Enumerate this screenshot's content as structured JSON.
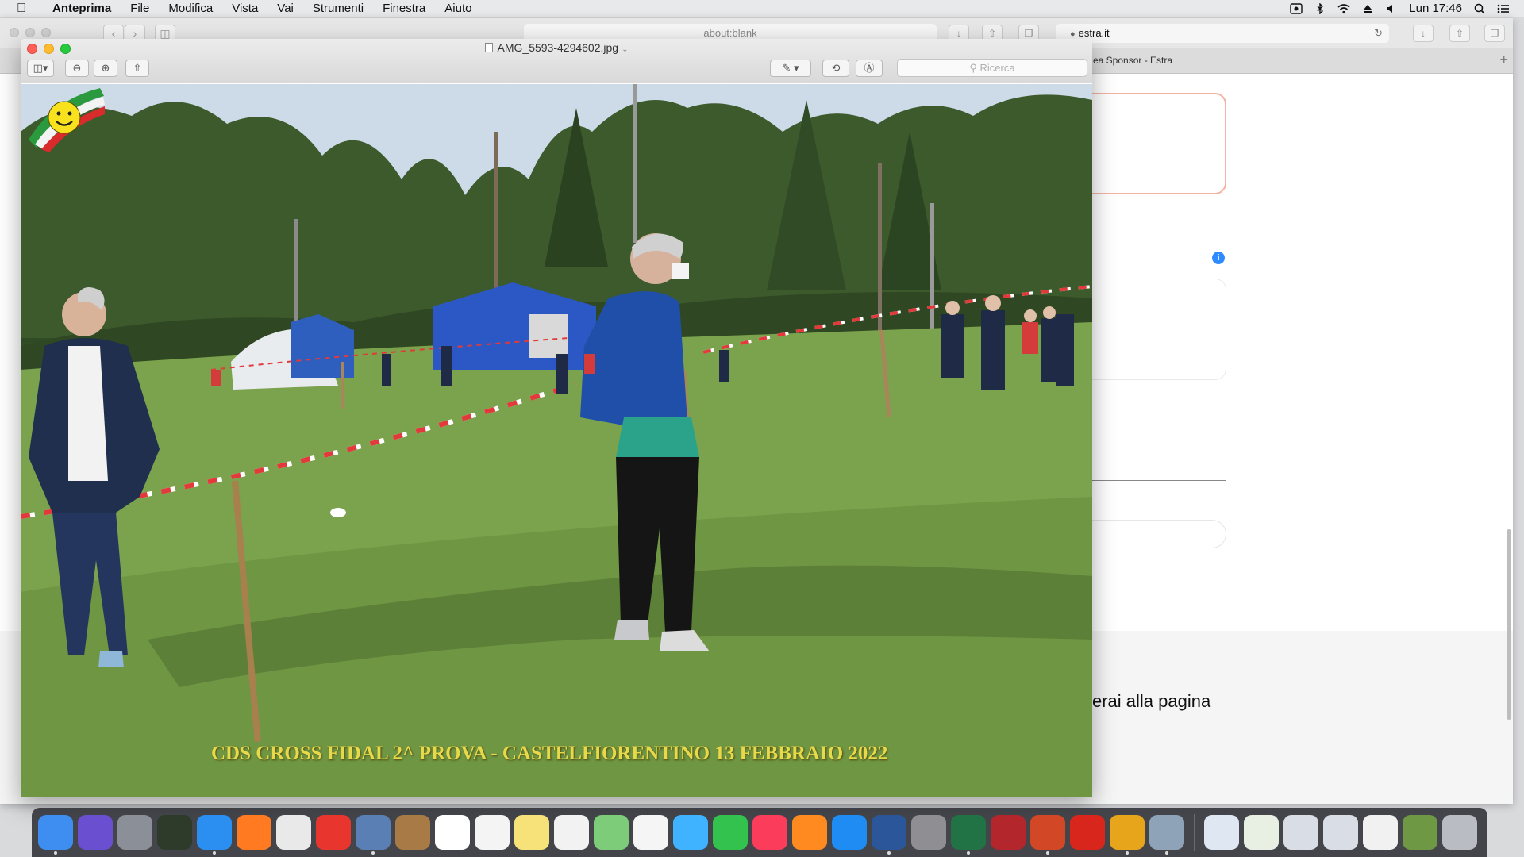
{
  "menubar": {
    "app_name": "Anteprima",
    "items": [
      "File",
      "Modifica",
      "Vista",
      "Vai",
      "Strumenti",
      "Finestra",
      "Aiuto"
    ],
    "clock": "Lun 17:46"
  },
  "safari": {
    "blank_url": "about:blank",
    "site_url": "estra.it",
    "tab_title": "ea Sponsor - Estra",
    "page_text": "erai alla pagina"
  },
  "preview": {
    "title": "AMG_5593-4294602.jpg",
    "search_placeholder": "Ricerca",
    "caption": "CDS CROSS FIDAL 2^ PROVA - CASTELFIORENTINO 13 FEBBRAIO 2022"
  },
  "dock": {
    "apps": [
      {
        "name": "finder-icon",
        "color": "#3d8ef0",
        "running": true
      },
      {
        "name": "siri-icon",
        "color": "#6a4fd0",
        "running": false
      },
      {
        "name": "launchpad-icon",
        "color": "#8a8f98",
        "running": false
      },
      {
        "name": "mission-control-icon",
        "color": "#2e3a2a",
        "running": false
      },
      {
        "name": "safari-icon",
        "color": "#2a8ff0",
        "running": true
      },
      {
        "name": "firefox-icon",
        "color": "#ff7a20",
        "running": false
      },
      {
        "name": "chrome-icon",
        "color": "#e9e9e9",
        "running": false
      },
      {
        "name": "anydesk-icon",
        "color": "#e8352d",
        "running": false
      },
      {
        "name": "preview-icon",
        "color": "#5a7fb5",
        "running": true
      },
      {
        "name": "notes-book-icon",
        "color": "#a87a45",
        "running": false
      },
      {
        "name": "calendar-icon",
        "color": "#ffffff",
        "running": false
      },
      {
        "name": "reminders-icon",
        "color": "#f4f4f4",
        "running": false
      },
      {
        "name": "stickies-icon",
        "color": "#f7e27a",
        "running": false
      },
      {
        "name": "textedit-icon",
        "color": "#f2f2f2",
        "running": false
      },
      {
        "name": "maps-icon",
        "color": "#7ccc7a",
        "running": false
      },
      {
        "name": "photos-icon",
        "color": "#f5f5f5",
        "running": false
      },
      {
        "name": "messages-icon",
        "color": "#3fb3ff",
        "running": false
      },
      {
        "name": "facetime-icon",
        "color": "#32c24d",
        "running": false
      },
      {
        "name": "music-icon",
        "color": "#fb3c5a",
        "running": false
      },
      {
        "name": "books-icon",
        "color": "#ff8a1f",
        "running": false
      },
      {
        "name": "app-store-icon",
        "color": "#1f8cf4",
        "running": false
      },
      {
        "name": "word-icon",
        "color": "#2b579a",
        "running": true
      },
      {
        "name": "system-preferences-icon",
        "color": "#8e8e93",
        "running": false
      },
      {
        "name": "excel-icon",
        "color": "#217346",
        "running": true
      },
      {
        "name": "photo-booth-icon",
        "color": "#b3262c",
        "running": false
      },
      {
        "name": "powerpoint-icon",
        "color": "#d24726",
        "running": true
      },
      {
        "name": "acrobat-icon",
        "color": "#d8261d",
        "running": false
      },
      {
        "name": "open-sign-icon",
        "color": "#e7a51c",
        "running": true
      },
      {
        "name": "image-capture-icon",
        "color": "#8ea2b8",
        "running": true
      }
    ],
    "docs": [
      {
        "name": "document-thumbnail-icon",
        "color": "#dfe7f2"
      },
      {
        "name": "spreadsheet-thumbnail-icon",
        "color": "#e7f0e2"
      },
      {
        "name": "window-thumbnail-icon",
        "color": "#d9dee6"
      },
      {
        "name": "window-thumbnail-icon",
        "color": "#d9dee6"
      },
      {
        "name": "text-thumbnail-icon",
        "color": "#f1f1f1"
      },
      {
        "name": "photo-thumbnail-icon",
        "color": "#6f9845"
      },
      {
        "name": "trash-icon",
        "color": "#b9bcc2"
      }
    ]
  }
}
